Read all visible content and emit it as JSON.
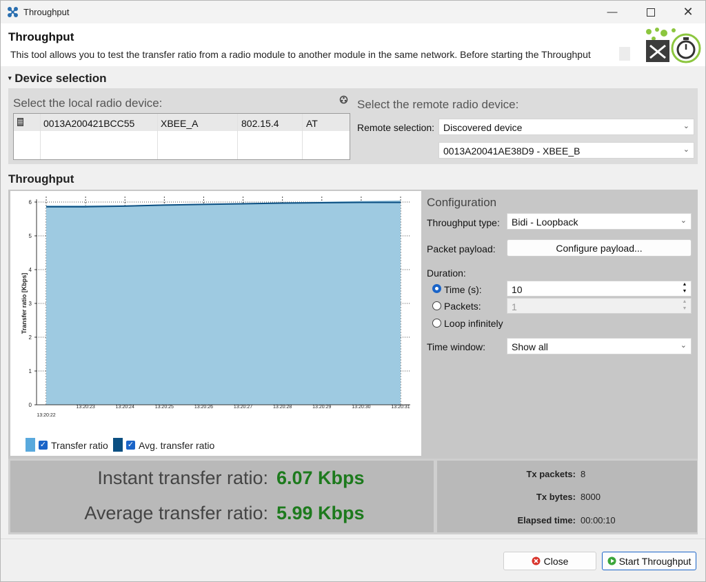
{
  "window": {
    "title": "Throughput"
  },
  "header": {
    "title": "Throughput",
    "description": "This tool allows you to test the transfer ratio from a radio module to another module in the same network. Before starting the Throughput"
  },
  "device_selection": {
    "section_label": "Device selection",
    "local_label": "Select the local radio device:",
    "local_device": {
      "mac": "0013A200421BCC55",
      "name": "XBEE_A",
      "protocol": "802.15.4",
      "mode": "AT"
    },
    "remote_label": "Select the remote radio device:",
    "remote_selection_label": "Remote selection:",
    "remote_selection_value": "Discovered device",
    "remote_device_value": "0013A20041AE38D9 - XBEE_B"
  },
  "throughput_section": {
    "label": "Throughput"
  },
  "chart_data": {
    "type": "area",
    "ylabel": "Transfer ratio [Kbps]",
    "xlabel": "",
    "ylim": [
      0,
      6
    ],
    "yticks": [
      0,
      1,
      2,
      3,
      4,
      5,
      6
    ],
    "x": [
      "13:20:22",
      "13:20:23",
      "13:20:24",
      "13:20:25",
      "13:20:26",
      "13:20:27",
      "13:20:28",
      "13:20:29",
      "13:20:30",
      "13:20:31"
    ],
    "series": [
      {
        "name": "Transfer ratio",
        "values": [
          5.9,
          5.9,
          5.9,
          5.93,
          5.95,
          5.97,
          5.99,
          6.01,
          6.03,
          6.05
        ],
        "color": "#9ecae1"
      },
      {
        "name": "Avg. transfer ratio",
        "values": [
          5.86,
          5.86,
          5.88,
          5.91,
          5.93,
          5.95,
          5.97,
          5.98,
          5.99,
          5.99
        ],
        "color": "#0b4f82"
      }
    ],
    "grid": true,
    "legend_position": "bottom-left"
  },
  "configuration": {
    "title": "Configuration",
    "throughput_type_label": "Throughput type:",
    "throughput_type_value": "Bidi - Loopback",
    "packet_payload_label": "Packet payload:",
    "configure_payload_button": "Configure payload...",
    "duration_label": "Duration:",
    "time_label": "Time (s):",
    "time_value": "10",
    "packets_label": "Packets:",
    "packets_value": "1",
    "loop_label": "Loop infinitely",
    "time_window_label": "Time window:",
    "time_window_value": "Show all"
  },
  "stats": {
    "instant_label": "Instant transfer ratio:",
    "instant_value": "6.07 Kbps",
    "average_label": "Average transfer ratio:",
    "average_value": "5.99 Kbps",
    "tx_packets_label": "Tx packets:",
    "tx_packets_value": "8",
    "tx_bytes_label": "Tx bytes:",
    "tx_bytes_value": "8000",
    "elapsed_label": "Elapsed time:",
    "elapsed_value": "00:00:10"
  },
  "footer": {
    "close_label": "Close",
    "start_label": "Start Throughput"
  }
}
